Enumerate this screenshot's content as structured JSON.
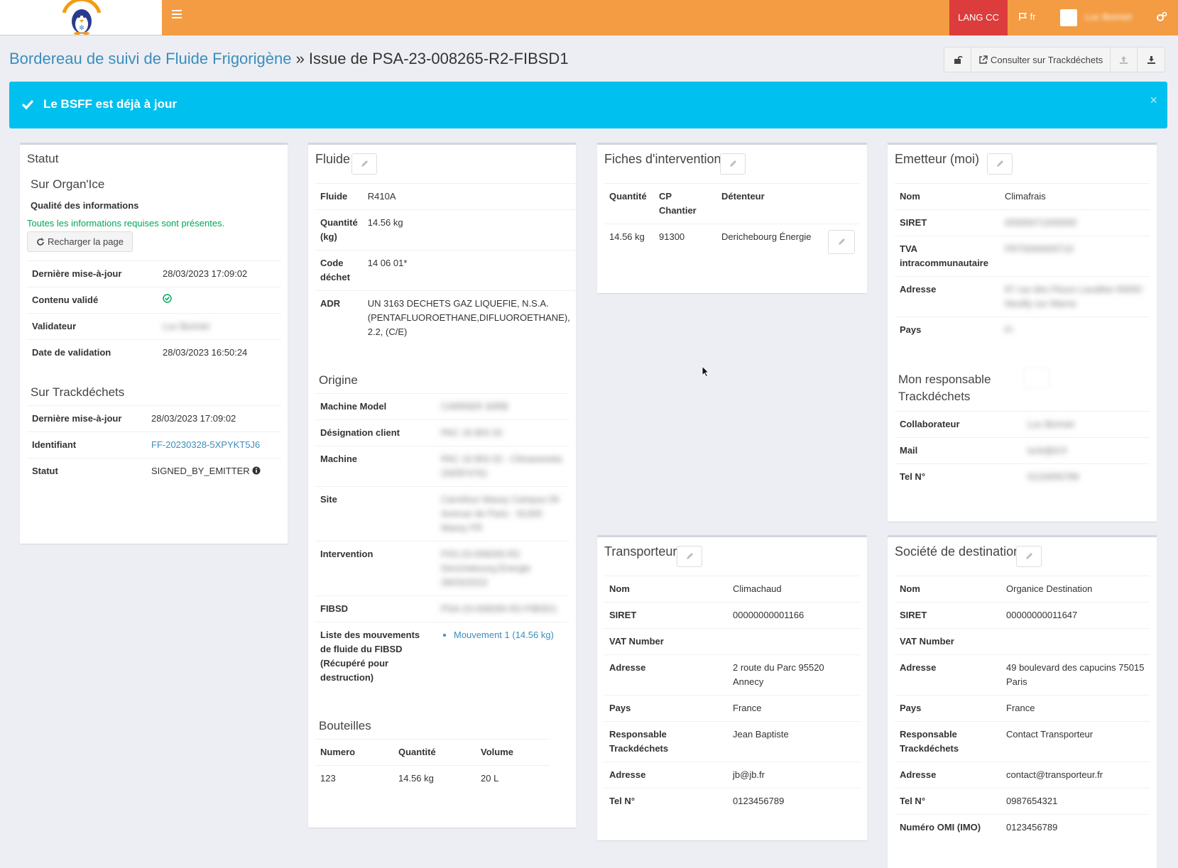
{
  "nav": {
    "lang_cc": "LANG CC",
    "lang": "fr",
    "user_name": "Luc Bonnet"
  },
  "header": {
    "breadcrumb": "Bordereau de suivi de Fluide Frigorigène",
    "separator": " » ",
    "title": "Issue de PSA-23-008265-R2-FIBSD1",
    "trackdechets_button": "Consulter sur Trackdéchets"
  },
  "alert": {
    "message": "Le BSFF est déjà à jour",
    "close": "×"
  },
  "status": {
    "title": "Statut",
    "organice_title": "Sur Organ'Ice",
    "quality_label": "Qualité des informations",
    "quality_message": "Toutes les informations requises sont présentes.",
    "reload_button": "Recharger la page",
    "rows": [
      {
        "label": "Dernière mise-à-jour",
        "value": "28/03/2023 17:09:02"
      },
      {
        "label": "Contenu validé",
        "value": ""
      },
      {
        "label": "Validateur",
        "value": "Luc Bonnet"
      },
      {
        "label": "Date de validation",
        "value": "28/03/2023 16:50:24"
      }
    ],
    "trackdechets_title": "Sur Trackdéchets",
    "td_rows": [
      {
        "label": "Dernière mise-à-jour",
        "value": "28/03/2023 17:09:02"
      },
      {
        "label": "Identifiant",
        "value": "FF-20230328-5XPYKT5J6"
      },
      {
        "label": "Statut",
        "value": "SIGNED_BY_EMITTER"
      }
    ]
  },
  "fluide": {
    "title": "Fluide",
    "rows": [
      {
        "label": "Fluide",
        "value": "R410A"
      },
      {
        "label": "Quantité (kg)",
        "value": "14.56 kg"
      },
      {
        "label": "Code déchet",
        "value": "14 06 01*"
      },
      {
        "label": "ADR",
        "value": "UN 3163 DECHETS GAZ LIQUEFIE, N.S.A. (PENTAFLUOROETHANE,DIFLUOROETHANE), 2.2, (C/E)"
      }
    ],
    "origine_title": "Origine",
    "origine_rows": [
      {
        "label": "Machine Model",
        "value": "CARRIER 30RB"
      },
      {
        "label": "Désignation client",
        "value": "PAC 16 BIS 02"
      },
      {
        "label": "Machine",
        "value": "PAC 16 BIS 02 - Climaveneta 2305F4761"
      },
      {
        "label": "Site",
        "value": "Carrefour Massy Campus 59 Avenue de Paris - 91300 Massy FR"
      },
      {
        "label": "Intervention",
        "value": "FIIS-23-008265-R2 Derichebourg Énergie 28/03/2023"
      },
      {
        "label": "FIBSD",
        "value": "PSA-23-008265-R2-FIBSD1"
      }
    ],
    "moves_label": "Liste des mouvements de fluide du FIBSD (Récupéré pour destruction)",
    "moves": [
      "Mouvement 1 (14.56 kg)"
    ],
    "bouteilles_title": "Bouteilles",
    "bouteilles_headers": [
      "Numero",
      "Quantité",
      "Volume"
    ],
    "bouteilles_rows": [
      [
        "123",
        "14.56 kg",
        "20 L"
      ]
    ]
  },
  "fiches": {
    "title": "Fiches d'intervention",
    "headers": [
      "Quantité",
      "CP Chantier",
      "Détenteur"
    ],
    "rows": [
      [
        "14.56 kg",
        "91300",
        "Derichebourg Énergie"
      ]
    ]
  },
  "emetteur": {
    "title": "Emetteur (moi)",
    "rows": [
      {
        "label": "Nom",
        "value": "Climafrais"
      },
      {
        "label": "SIRET",
        "value": "00000071000000"
      },
      {
        "label": "TVA intracommunautaire",
        "value": "FR75000000710"
      },
      {
        "label": "Adresse",
        "value": "97 rue des Fleurs Lavallee 93000 Neuilly sur Marne"
      },
      {
        "label": "Pays",
        "value": "Fr"
      }
    ],
    "resp_title": "Mon responsable Trackdéchets",
    "resp_rows": [
      {
        "label": "Collaborateur",
        "value": "Luc Bonnet"
      },
      {
        "label": "Mail",
        "value": "lucb@d.fr"
      },
      {
        "label": "Tel N°",
        "value": "0123456789"
      }
    ]
  },
  "transporteur": {
    "title": "Transporteur",
    "rows": [
      {
        "label": "Nom",
        "value": "Climachaud"
      },
      {
        "label": "SIRET",
        "value": "00000000001166"
      },
      {
        "label": "VAT Number",
        "value": ""
      },
      {
        "label": "Adresse",
        "value": "2 route du Parc 95520 Annecy"
      },
      {
        "label": "Pays",
        "value": "France"
      },
      {
        "label": "Responsable Trackdéchets",
        "value": "Jean Baptiste"
      },
      {
        "label": "Adresse",
        "value": "jb@jb.fr"
      },
      {
        "label": "Tel N°",
        "value": "0123456789"
      }
    ]
  },
  "destination": {
    "title": "Société de destination",
    "rows": [
      {
        "label": "Nom",
        "value": "Organice Destination"
      },
      {
        "label": "SIRET",
        "value": "00000000011647"
      },
      {
        "label": "VAT Number",
        "value": ""
      },
      {
        "label": "Adresse",
        "value": "49 boulevard des capucins 75015 Paris"
      },
      {
        "label": "Pays",
        "value": "France"
      },
      {
        "label": "Responsable Trackdéchets",
        "value": "Contact Transporteur"
      },
      {
        "label": "Adresse",
        "value": "contact@transporteur.fr"
      },
      {
        "label": "Tel N°",
        "value": "0987654321"
      },
      {
        "label": "Numéro OMI (IMO)",
        "value": "0123456789"
      }
    ]
  },
  "colors": {
    "navbar": "#f39c43",
    "lang_cc": "#dd3c3c",
    "alert": "#00c0ef",
    "link": "#3c8dbc",
    "success": "#00a65a"
  }
}
